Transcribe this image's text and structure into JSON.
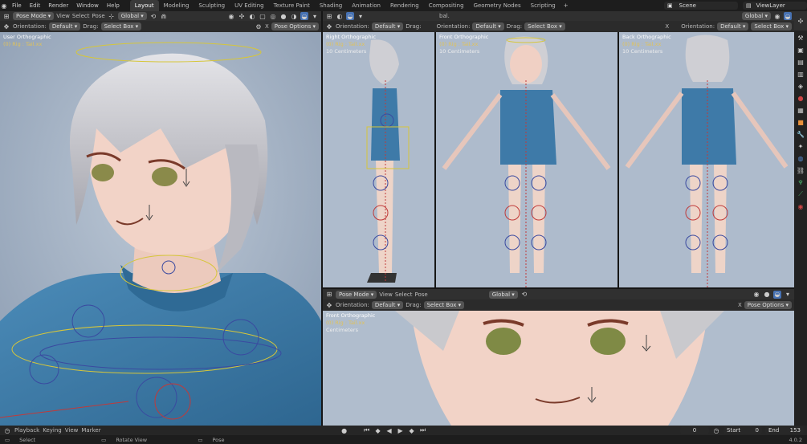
{
  "topbar": {
    "menus": [
      "File",
      "Edit",
      "Render",
      "Window",
      "Help"
    ],
    "tabs": [
      "Layout",
      "Modeling",
      "Sculpting",
      "UV Editing",
      "Texture Paint",
      "Shading",
      "Animation",
      "Rendering",
      "Compositing",
      "Geometry Nodes",
      "Scripting"
    ],
    "active_tab": "Layout",
    "scene": "Scene",
    "view_layer": "ViewLayer"
  },
  "header": {
    "mode": "Pose Mode",
    "view": "View",
    "select": "Select",
    "pose": "Pose",
    "transform": "Global",
    "orientation_label": "Orientation:",
    "orientation": "Default",
    "drag_label": "Drag:",
    "drag": "Select Box",
    "pose_options": "Pose Options",
    "x": "X",
    "global_short": "bal."
  },
  "viewports": {
    "main": {
      "title": "User Orthographic",
      "collection": "(0) Rig : Tail.xx",
      "scale": ""
    },
    "right": {
      "title": "Right Orthographic",
      "collection": "(0) Rig : Tail.xx",
      "scale": "10 Centimeters"
    },
    "front": {
      "title": "Front Orthographic",
      "collection": "(0) Rig : Tail.xx",
      "scale": "10 Centimeters"
    },
    "back": {
      "title": "Back Orthographic",
      "collection": "(0) Rig : Tail.xx",
      "scale": "10 Centimeters"
    },
    "front2": {
      "title": "Front Orthographic",
      "collection": "(0) Rig : Tail.xx",
      "scale": "Centimeters"
    }
  },
  "timeline": {
    "playback": "Playback",
    "keying": "Keying",
    "view": "View",
    "marker": "Marker",
    "frame": "0",
    "start_label": "Start",
    "start": "0",
    "end_label": "End",
    "end": "153"
  },
  "status": {
    "select": "Select",
    "rotate": "Rotate View",
    "pose": "Pose",
    "version": "4.0.2"
  },
  "colors": {
    "accent": "#4772b3",
    "bg_viewport": "#a7b6c8",
    "shirt": "#3e7aa8",
    "skin": "#f0d0c4",
    "hair": "#c9c9cd",
    "bone_yellow": "#d6c63a"
  }
}
